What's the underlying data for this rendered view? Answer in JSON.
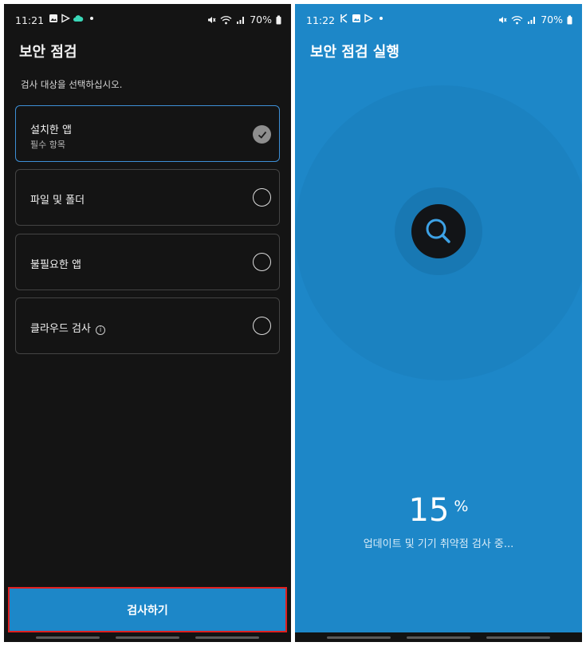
{
  "left_screen": {
    "status": {
      "time": "11:21",
      "battery": "70%"
    },
    "title": "보안 점검",
    "instruction": "검사 대상을 선택하십시오.",
    "options": [
      {
        "label": "설치한 앱",
        "sublabel": "필수 항목",
        "selected": true
      },
      {
        "label": "파일 및 폴더",
        "selected": false
      },
      {
        "label": "불필요한 앱",
        "selected": false
      },
      {
        "label": "클라우드 검사",
        "selected": false,
        "info_icon": "info-icon"
      }
    ],
    "scan_button": "검사하기"
  },
  "right_screen": {
    "status": {
      "time": "11:22",
      "battery": "70%"
    },
    "title": "보안 점검 실행",
    "progress_value": "15",
    "progress_unit": "%",
    "progress_text": "업데이트 및 기기 취약점 검사 중..."
  },
  "colors": {
    "dark_background": "#141414",
    "accent_blue": "#1d87c8",
    "selected_border": "#3d8fd6",
    "highlight_red": "#e02020"
  },
  "icons": [
    "image-icon",
    "play-store-icon",
    "cloud-icon",
    "mute-icon",
    "wifi-icon",
    "signal-icon",
    "battery-icon",
    "check-icon",
    "search-icon"
  ]
}
